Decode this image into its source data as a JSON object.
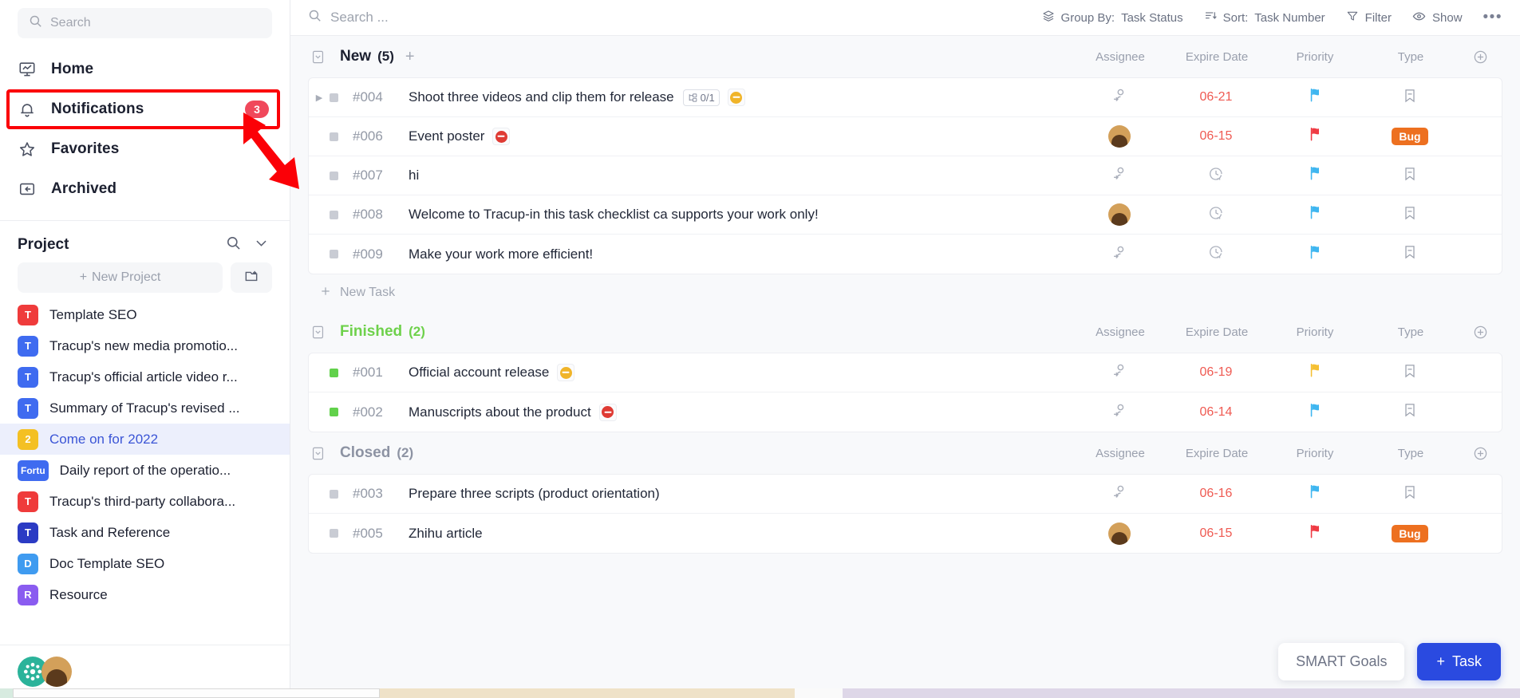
{
  "sidebar": {
    "search": {
      "placeholder": "Search",
      "icon": "search-icon"
    },
    "nav": [
      {
        "label": "Home",
        "icon": "monitor-chart-icon",
        "badge": ""
      },
      {
        "label": "Notifications",
        "icon": "bell-icon",
        "badge": "3"
      },
      {
        "label": "Favorites",
        "icon": "star-icon",
        "badge": ""
      },
      {
        "label": "Archived",
        "icon": "archive-box-icon",
        "badge": ""
      }
    ],
    "project_section": {
      "title": "Project",
      "search_icon": "search-icon",
      "collapse_icon": "chevron-down-icon",
      "new_project_label": "New Project",
      "new_project_plus": "+",
      "new_folder_icon": "folder-plus-icon"
    },
    "projects": [
      {
        "label": "Template SEO",
        "icon_text": "T",
        "color": "#ef3b3b",
        "active": false
      },
      {
        "label": "Tracup's new media promotio...",
        "icon_text": "T",
        "color": "#3f6bf0",
        "active": false
      },
      {
        "label": "Tracup's official article video r...",
        "icon_text": "T",
        "color": "#3f6bf0",
        "active": false
      },
      {
        "label": "Summary of Tracup's revised ...",
        "icon_text": "T",
        "color": "#3f6bf0",
        "active": false
      },
      {
        "label": "Come on for 2022",
        "icon_text": "2",
        "color": "#f4c023",
        "active": true
      },
      {
        "label": "Daily report of the operatio...",
        "icon_text": "Fortu",
        "color": "#3f6bf0",
        "active": false,
        "wide": true
      },
      {
        "label": "Tracup's third-party collabora...",
        "icon_text": "T",
        "color": "#ef3b3b",
        "active": false
      },
      {
        "label": "Task and Reference",
        "icon_text": "T",
        "color": "#2b3bc4",
        "active": false
      },
      {
        "label": "Doc Template SEO",
        "icon_text": "D",
        "color": "#3f9bf0",
        "active": false
      },
      {
        "label": "Resource",
        "icon_text": "R",
        "color": "#8a5cf0",
        "active": false
      }
    ],
    "avatars": [
      "avatar-teal-flower",
      "avatar-person"
    ]
  },
  "topbar": {
    "search_placeholder": "Search ...",
    "search_icon": "search-icon",
    "group_by_label": "Group By:",
    "group_by_value": "Task Status",
    "group_by_icon": "layers-icon",
    "sort_label": "Sort:",
    "sort_value": "Task Number",
    "sort_icon": "sort-icon",
    "filter_label": "Filter",
    "filter_icon": "funnel-icon",
    "show_label": "Show",
    "show_icon": "eye-icon",
    "more_icon": "ellipsis-icon",
    "more_label": "•••"
  },
  "columns": {
    "assignee": "Assignee",
    "expire_date": "Expire Date",
    "priority": "Priority",
    "type": "Type",
    "add_icon": "plus-circle-icon"
  },
  "new_task_label": "New Task",
  "groups": [
    {
      "name": "New",
      "count": "(5)",
      "color": "#1c2030",
      "add_label": "+",
      "show_new_task": true,
      "tasks": [
        {
          "num": "#004",
          "title": "Shoot three videos and clip them for release",
          "twist": "▶",
          "dot": "grey",
          "subtask": "0/1",
          "subtask_icon": "subtask-icon",
          "emoji": "no-entry-yellow",
          "assignee": "none",
          "assignee_icon": "add-person-icon",
          "date": "06-21",
          "date_icon": "",
          "priority": "flag-blue",
          "type": "bookmark-icon",
          "type_tag": ""
        },
        {
          "num": "#006",
          "title": "Event poster",
          "twist": "",
          "dot": "grey",
          "subtask": "",
          "emoji": "no-entry-red",
          "assignee": "avatar",
          "assignee_icon": "",
          "date": "06-15",
          "date_icon": "",
          "priority": "flag-red",
          "type": "tag",
          "type_tag": "Bug"
        },
        {
          "num": "#007",
          "title": "hi",
          "twist": "",
          "dot": "grey",
          "subtask": "",
          "emoji": "",
          "assignee": "none",
          "assignee_icon": "add-person-icon",
          "date": "",
          "date_icon": "clock-icon",
          "priority": "flag-blue",
          "type": "bookmark-icon",
          "type_tag": ""
        },
        {
          "num": "#008",
          "title": "Welcome to Tracup-in this task checklist ca supports your work only!",
          "twist": "",
          "dot": "grey",
          "subtask": "",
          "emoji": "",
          "assignee": "avatar",
          "assignee_icon": "",
          "date": "",
          "date_icon": "clock-icon",
          "priority": "flag-blue",
          "type": "bookmark-icon",
          "type_tag": ""
        },
        {
          "num": "#009",
          "title": "Make your work more efficient!",
          "twist": "",
          "dot": "grey",
          "subtask": "",
          "emoji": "",
          "assignee": "none",
          "assignee_icon": "add-person-icon",
          "date": "",
          "date_icon": "clock-icon",
          "priority": "flag-blue",
          "type": "bookmark-icon",
          "type_tag": ""
        }
      ]
    },
    {
      "name": "Finished",
      "count": "(2)",
      "color": "#6ed14b",
      "add_label": "",
      "show_new_task": false,
      "tasks": [
        {
          "num": "#001",
          "title": "Official account release",
          "twist": "",
          "dot": "green",
          "subtask": "",
          "emoji": "no-entry-yellow",
          "assignee": "none",
          "assignee_icon": "add-person-icon",
          "date": "06-19",
          "date_icon": "",
          "priority": "flag-yellow",
          "type": "bookmark-icon",
          "type_tag": ""
        },
        {
          "num": "#002",
          "title": "Manuscripts about the product",
          "twist": "",
          "dot": "green",
          "subtask": "",
          "emoji": "no-entry-red",
          "assignee": "none",
          "assignee_icon": "add-person-icon",
          "date": "06-14",
          "date_icon": "",
          "priority": "flag-blue",
          "type": "bookmark-icon",
          "type_tag": ""
        }
      ]
    },
    {
      "name": "Closed",
      "count": "(2)",
      "color": "#8d93a3",
      "add_label": "",
      "show_new_task": false,
      "tasks": [
        {
          "num": "#003",
          "title": "Prepare three scripts (product orientation)",
          "twist": "",
          "dot": "grey",
          "subtask": "",
          "emoji": "",
          "assignee": "none",
          "assignee_icon": "add-person-icon",
          "date": "06-16",
          "date_icon": "",
          "priority": "flag-blue",
          "type": "bookmark-icon",
          "type_tag": ""
        },
        {
          "num": "#005",
          "title": "Zhihu article",
          "twist": "",
          "dot": "grey",
          "subtask": "",
          "emoji": "",
          "assignee": "avatar",
          "assignee_icon": "",
          "date": "06-15",
          "date_icon": "",
          "priority": "flag-red",
          "type": "tag",
          "type_tag": "Bug"
        }
      ]
    }
  ],
  "fabs": {
    "smart_goals": "SMART Goals",
    "task": "Task",
    "task_plus": "+"
  },
  "annotation": {
    "highlight_color": "#fb0007",
    "arrow_color": "#fb0007",
    "highlights": "notifications-row"
  }
}
